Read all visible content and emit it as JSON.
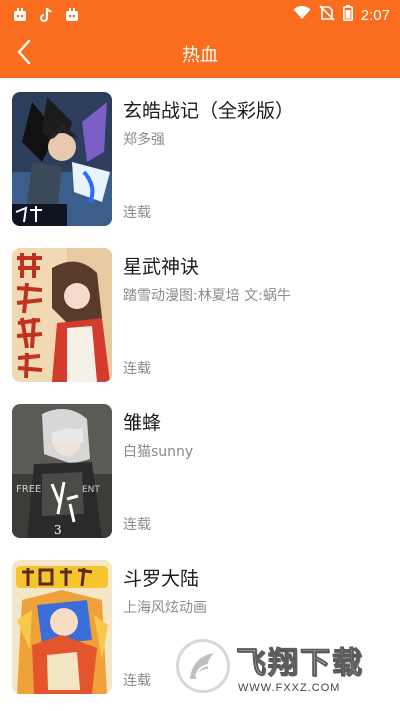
{
  "status_bar": {
    "time": "2:07",
    "left_icons": [
      "app-notification-icon",
      "tiktok-icon",
      "app-notification-icon"
    ],
    "right_icons": [
      "wifi-icon",
      "no-sim-icon",
      "battery-icon"
    ]
  },
  "app_bar": {
    "title": "热血",
    "back_icon": "back-arrow-icon",
    "background": "#fa6d1e"
  },
  "comics": [
    {
      "title": "玄皓战记（全彩版）",
      "author": "郑多强",
      "status": "连载"
    },
    {
      "title": "星武神诀",
      "author": "踏雪动漫图:林夏培 文:蜗牛",
      "status": "连载"
    },
    {
      "title": "雏蜂",
      "author": "白猫sunny",
      "status": "连载"
    },
    {
      "title": "斗罗大陆",
      "author": "上海风炫动画",
      "status": "连载"
    }
  ],
  "watermark": {
    "brand": "飞翔下载",
    "url": "WWW.FXXZ.COM"
  }
}
